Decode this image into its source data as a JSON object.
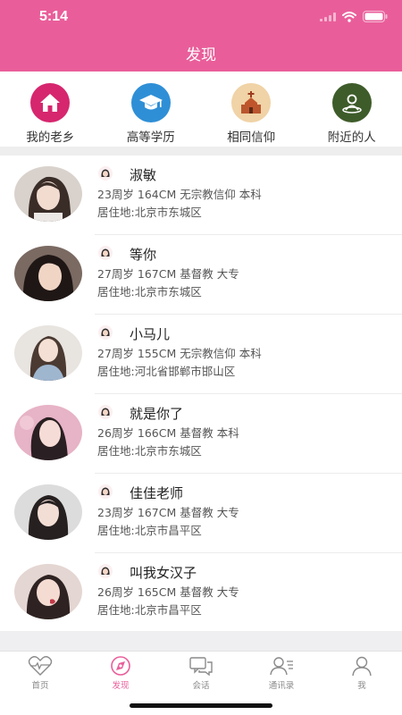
{
  "status_bar": {
    "time": "5:14"
  },
  "header": {
    "title": "发现"
  },
  "categories": [
    {
      "label": "我的老乡",
      "icon": "home-icon",
      "color": "#d6266e"
    },
    {
      "label": "高等学历",
      "icon": "graduation-cap-icon",
      "color": "#2f8fd6"
    },
    {
      "label": "相同信仰",
      "icon": "church-icon",
      "color": "#e8c591"
    },
    {
      "label": "附近的人",
      "icon": "location-person-icon",
      "color": "#3e5c2a"
    }
  ],
  "users": [
    {
      "name": "淑敏",
      "info": "23周岁 164CM 无宗教信仰 本科",
      "address": "居住地:北京市东城区"
    },
    {
      "name": "等你",
      "info": "27周岁 167CM 基督教 大专",
      "address": "居住地:北京市东城区"
    },
    {
      "name": "小马儿",
      "info": "27周岁 155CM 无宗教信仰 本科",
      "address": "居住地:河北省邯郸市邯山区"
    },
    {
      "name": "就是你了",
      "info": "26周岁 166CM 基督教 本科",
      "address": "居住地:北京市东城区"
    },
    {
      "name": "佳佳老师",
      "info": "23周岁 167CM 基督教 大专",
      "address": "居住地:北京市昌平区"
    },
    {
      "name": "叫我女汉子",
      "info": "26周岁 165CM 基督教 大专",
      "address": "居住地:北京市昌平区"
    }
  ],
  "tabbar": [
    {
      "label": "首页",
      "icon": "heartbeat-icon"
    },
    {
      "label": "发现",
      "icon": "discover-icon",
      "active": true
    },
    {
      "label": "会话",
      "icon": "chat-bubbles-icon"
    },
    {
      "label": "通讯录",
      "icon": "contacts-icon"
    },
    {
      "label": "我",
      "icon": "person-icon"
    }
  ],
  "colors": {
    "accent": "#e95e9a",
    "background": "#ffffff",
    "separator": "#eeeeee"
  }
}
